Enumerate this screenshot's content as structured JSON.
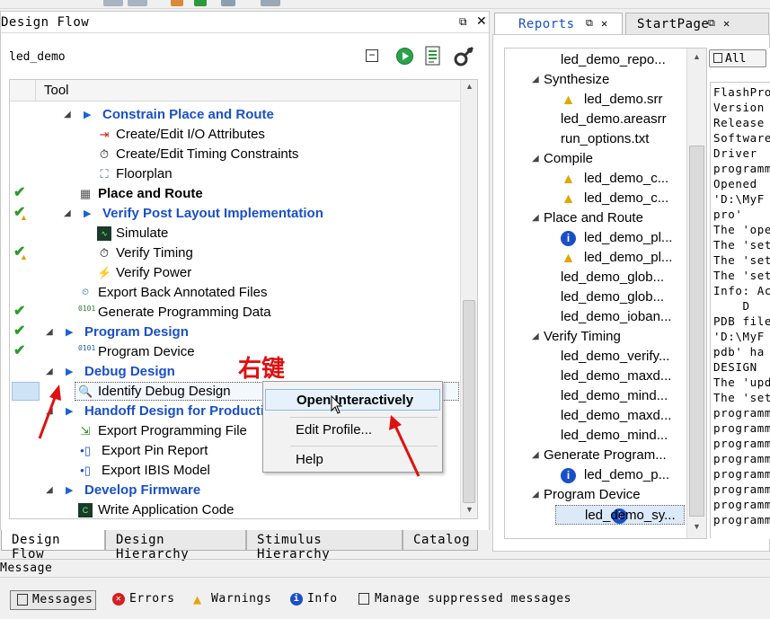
{
  "design_flow": {
    "title": "Design Flow",
    "project": "led_demo",
    "tree_header": "Tool",
    "rows": [
      {
        "label": "Constrain Place and Route",
        "style": "blue"
      },
      {
        "label": "Create/Edit I/O Attributes"
      },
      {
        "label": "Create/Edit Timing Constraints"
      },
      {
        "label": "Floorplan"
      },
      {
        "label": "Place and Route",
        "style": "bold"
      },
      {
        "label": "Verify Post Layout Implementation",
        "style": "blue"
      },
      {
        "label": "Simulate"
      },
      {
        "label": "Verify Timing"
      },
      {
        "label": "Verify Power"
      },
      {
        "label": "Export Back Annotated Files"
      },
      {
        "label": "Generate Programming Data"
      },
      {
        "label": "Program Design",
        "style": "blue"
      },
      {
        "label": "Program Device"
      },
      {
        "label": "Debug Design",
        "style": "blue"
      },
      {
        "label": "Identify Debug Design"
      },
      {
        "label": "Handoff Design for Production",
        "style": "blue"
      },
      {
        "label": "Export Programming File"
      },
      {
        "label": "Export Pin Report"
      },
      {
        "label": "Export IBIS Model"
      },
      {
        "label": "Develop Firmware",
        "style": "blue"
      },
      {
        "label": "Write Application Code"
      }
    ],
    "tabs": [
      "Design Flow",
      "Design Hierarchy",
      "Stimulus Hierarchy",
      "Catalog"
    ]
  },
  "context_menu": {
    "items": [
      "Open Interactively",
      "Edit Profile...",
      "Help"
    ]
  },
  "annotation": {
    "text": "右键"
  },
  "reports": {
    "tabs": [
      "Reports",
      "StartPage"
    ],
    "rows": [
      {
        "label": "led_demo_repo..."
      },
      {
        "label": "Synthesize"
      },
      {
        "label": "led_demo.srr",
        "icon": "warning"
      },
      {
        "label": "led_demo.areasrr"
      },
      {
        "label": "run_options.txt"
      },
      {
        "label": "Compile"
      },
      {
        "label": "led_demo_c...",
        "icon": "warning"
      },
      {
        "label": "led_demo_c...",
        "icon": "warning"
      },
      {
        "label": "Place and Route"
      },
      {
        "label": "led_demo_pl...",
        "icon": "info"
      },
      {
        "label": "led_demo_pl...",
        "icon": "warning"
      },
      {
        "label": "led_demo_glob..."
      },
      {
        "label": "led_demo_glob..."
      },
      {
        "label": "led_demo_ioban..."
      },
      {
        "label": "Verify Timing"
      },
      {
        "label": "led_demo_verify..."
      },
      {
        "label": "led_demo_maxd..."
      },
      {
        "label": "led_demo_mind..."
      },
      {
        "label": "led_demo_maxd..."
      },
      {
        "label": "led_demo_mind..."
      },
      {
        "label": "Generate Program..."
      },
      {
        "label": "led_demo_p...",
        "icon": "info"
      },
      {
        "label": "Program Device"
      },
      {
        "label": "led_demo_sy...",
        "icon": "info"
      }
    ],
    "log_filter": "All",
    "log_lines": [
      "FlashPro",
      "Version",
      "Release",
      "",
      "Software",
      "Driver",
      "programm",
      "Opened",
      "'D:\\MyF",
      "pro'",
      "The 'ope",
      "The 'set",
      "The 'set",
      "The 'set",
      "Info: Ac",
      "    D",
      "PDB file",
      "'D:\\MyF",
      "pdb' ha",
      "DESIGN",
      "The 'upd",
      "The 'set",
      "programm",
      "programm",
      "programm",
      "programm",
      "programm",
      "programm",
      "programm",
      "programm"
    ]
  },
  "messages": {
    "title": "Message",
    "tabs": [
      {
        "label": "Messages",
        "icon": "list-icon"
      },
      {
        "label": "Errors",
        "icon": "error-icon"
      },
      {
        "label": "Warnings",
        "icon": "warning-icon"
      },
      {
        "label": "Info",
        "icon": "info-icon"
      },
      {
        "label": "Manage suppressed messages",
        "icon": "list-icon"
      }
    ]
  }
}
